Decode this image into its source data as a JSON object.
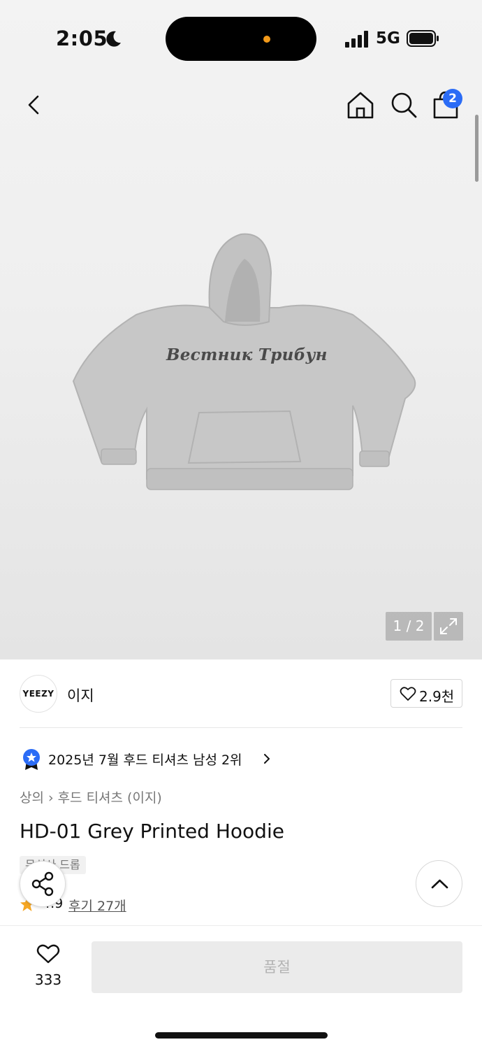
{
  "status_bar": {
    "time": "2:05",
    "network": "5G"
  },
  "nav": {
    "cart_count": "2"
  },
  "gallery": {
    "counter": "1 / 2",
    "print_text": "Вестник Трибун"
  },
  "brand": {
    "logo_text": "YEEZY",
    "name": "이지",
    "like_count": "2.9천"
  },
  "ranking": {
    "text": "2025년 7월 후드 티셔츠 남성 2위"
  },
  "breadcrumb": {
    "level1": "상의",
    "level2": "후드 티셔츠 (이지)"
  },
  "product": {
    "title": "HD-01 Grey Printed Hoodie",
    "tag": "무신사 드롭",
    "rating": "4.9",
    "review_link": "후기 27개"
  },
  "bottom_bar": {
    "wish_count": "333",
    "purchase_label": "품절"
  },
  "colors": {
    "accent_blue": "#2b6cf6",
    "star_orange": "#f5a623",
    "soldout_bg": "#ebebeb"
  }
}
